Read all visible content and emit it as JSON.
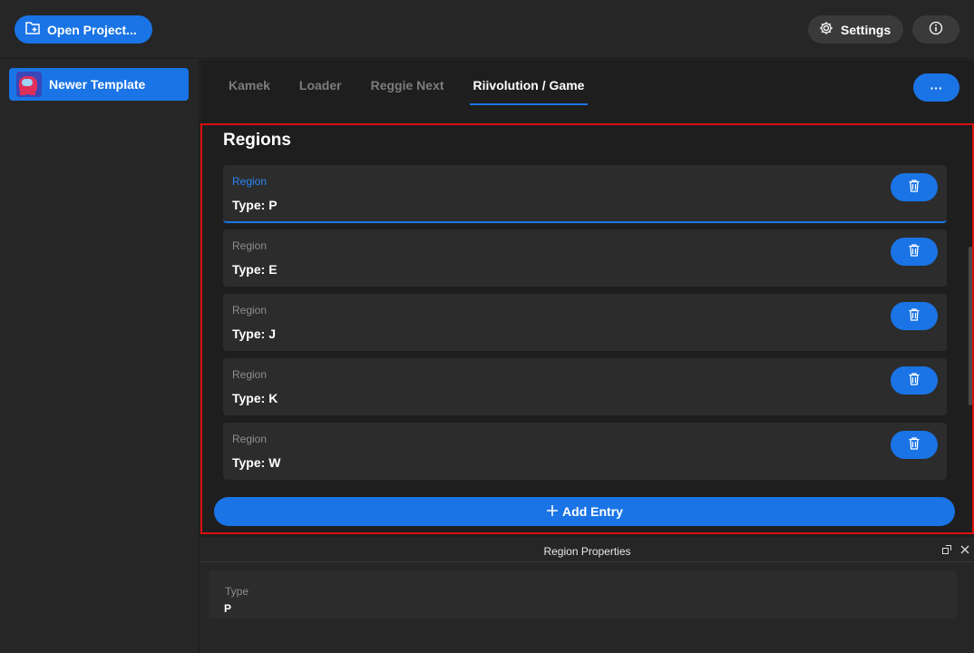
{
  "header": {
    "open_project_label": "Open Project...",
    "settings_label": "Settings"
  },
  "sidebar": {
    "items": [
      {
        "label": "Newer Template",
        "icon": "project-avatar-icon"
      }
    ]
  },
  "tabs": [
    {
      "label": "Kamek"
    },
    {
      "label": "Loader"
    },
    {
      "label": "Reggie Next"
    },
    {
      "label": "Riivolution / Game"
    }
  ],
  "more_label": "···",
  "section": {
    "title": "Regions",
    "entries": [
      {
        "label": "Region",
        "value": "Type: P"
      },
      {
        "label": "Region",
        "value": "Type: E"
      },
      {
        "label": "Region",
        "value": "Type: J"
      },
      {
        "label": "Region",
        "value": "Type: K"
      },
      {
        "label": "Region",
        "value": "Type: W"
      }
    ],
    "add_label": "Add Entry"
  },
  "properties": {
    "title": "Region Properties",
    "field_label": "Type",
    "field_value": "P"
  },
  "colors": {
    "accent": "#1a74e6",
    "focus_border": "#d90f0f",
    "background": "#262626"
  }
}
